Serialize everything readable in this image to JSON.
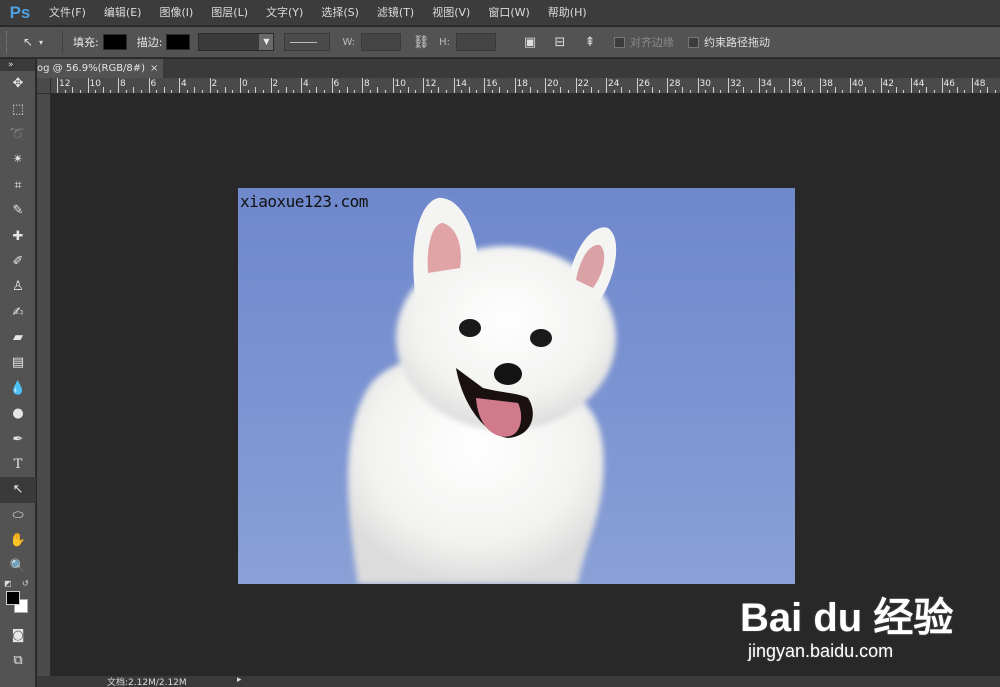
{
  "app": {
    "logo": "Ps"
  },
  "menu": [
    "文件(F)",
    "编辑(E)",
    "图像(I)",
    "图层(L)",
    "文字(Y)",
    "选择(S)",
    "滤镜(T)",
    "视图(V)",
    "窗口(W)",
    "帮助(H)"
  ],
  "options": {
    "fill_label": "填充:",
    "stroke_label": "描边:",
    "w_label": "W:",
    "h_label": "H:",
    "align_edges_label": "对齐边缘",
    "constrain_path_label": "约束路径拖动"
  },
  "document": {
    "tab_title": "og @ 56.9%(RGB/8#)",
    "tab_close": "×",
    "watermark_text": "xiaoxue123.com"
  },
  "ruler": {
    "labels": [
      "12",
      "10",
      "8",
      "6",
      "4",
      "2",
      "0",
      "2",
      "4",
      "6",
      "8",
      "10",
      "12",
      "14",
      "16",
      "18",
      "20",
      "22",
      "24",
      "26",
      "28",
      "30",
      "32",
      "34",
      "36",
      "38",
      "40",
      "42",
      "44",
      "46",
      "48"
    ]
  },
  "status": {
    "doc_info": "文档:2.12M/2.12M",
    "arrow": "▸"
  },
  "brand": {
    "logo": "Bai du 经验",
    "url": "jingyan.baidu.com"
  },
  "colors": {
    "menubar": "#3c3c3c",
    "panel": "#535353",
    "canvas_bg": "#282828",
    "ps_blue": "#4ea0e0",
    "sky": "#7b93d1"
  }
}
